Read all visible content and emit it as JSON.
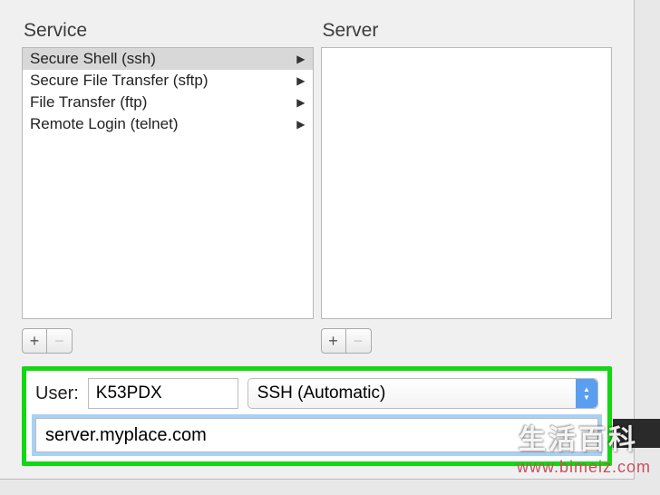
{
  "headers": {
    "service": "Service",
    "server": "Server"
  },
  "services": [
    {
      "label": "Secure Shell (ssh)",
      "selected": true
    },
    {
      "label": "Secure File Transfer (sftp)",
      "selected": false
    },
    {
      "label": "File Transfer (ftp)",
      "selected": false
    },
    {
      "label": "Remote Login (telnet)",
      "selected": false
    }
  ],
  "servers": [],
  "buttons": {
    "add": "+",
    "remove": "−"
  },
  "form": {
    "user_label": "User:",
    "user_value": "K53PDX",
    "protocol_selected": "SSH (Automatic)",
    "server_value": "server.myplace.com"
  },
  "watermark": {
    "title": "生活百科",
    "url": "www.bimeiz.com"
  }
}
